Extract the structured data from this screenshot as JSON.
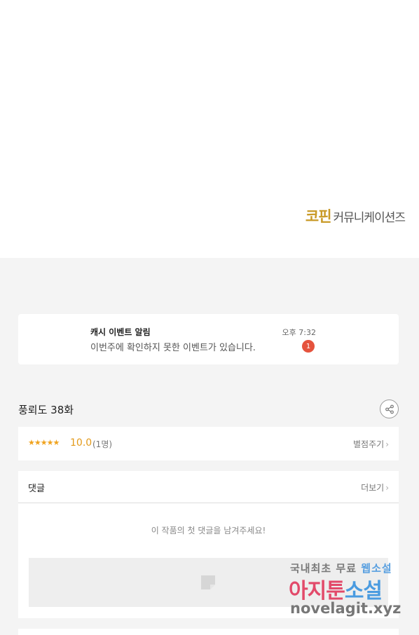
{
  "publisher": {
    "brand": "코핀",
    "rest": "커뮤니케이션즈"
  },
  "notification": {
    "title": "캐시 이벤트 알림",
    "message": "이번주에 확인하지 못한 이벤트가 있습니다.",
    "time": "오후 7:32",
    "badge": "1"
  },
  "episode": {
    "title": "풍뢰도 38화",
    "share_icon": "share-icon"
  },
  "rating": {
    "stars": "★★★★★",
    "score": "10.0",
    "count": "(1명)",
    "rate_label": "별점주기",
    "chevron": "›"
  },
  "comments": {
    "title": "댓글",
    "more_label": "더보기",
    "chevron": "›",
    "empty_message": "이 작품의 첫 댓글을 남겨주세요!"
  },
  "watermark": {
    "line1_prefix": "국내최초 무료",
    "line1_accent": "웹소설",
    "line2_prefix": "아지툰",
    "line2_accent": "소설",
    "line3": "novelagit.xyz"
  },
  "colors": {
    "brand_gold": "#c99a27",
    "star": "#f0a31e",
    "badge": "#e5533d",
    "background": "#f4f4f4"
  }
}
